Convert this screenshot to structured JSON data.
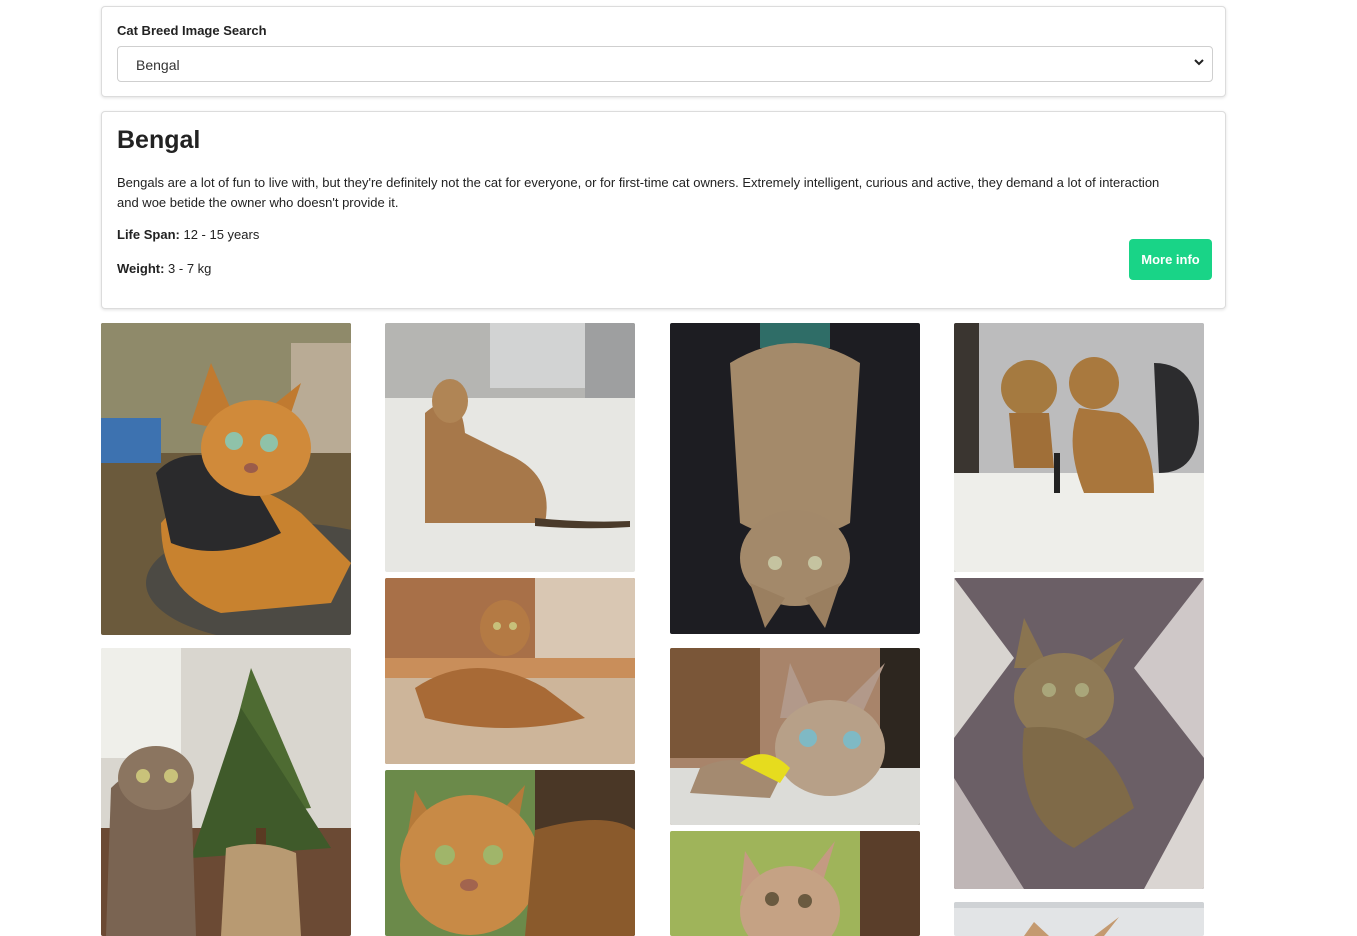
{
  "search": {
    "label": "Cat Breed Image Search",
    "selected": "Bengal"
  },
  "breed": {
    "name": "Bengal",
    "description": "Bengals are a lot of fun to live with, but they're definitely not the cat for everyone, or for first-time cat owners. Extremely intelligent, curious and active, they demand a lot of interaction and woe betide the owner who doesn't provide it.",
    "life_span_label": "Life Span:",
    "life_span": "12 - 15 years",
    "weight_label": "Weight:",
    "weight": "3 - 7 kg",
    "more_info_label": "More info"
  },
  "colors": {
    "accent": "#19d487"
  },
  "gallery": [
    {
      "scene": "bengal-harness-outdoor"
    },
    {
      "scene": "bengal-sitting-floor"
    },
    {
      "scene": "bengal-upside-down"
    },
    {
      "scene": "bengal-mirror"
    },
    {
      "scene": "bengal-christmas-tree"
    },
    {
      "scene": "bengal-on-bed"
    },
    {
      "scene": "bengal-closeup"
    },
    {
      "scene": "bengal-with-toy"
    },
    {
      "scene": "bengal-fur-blanket"
    },
    {
      "scene": "bengal-kitten"
    },
    {
      "scene": "bengal-partial"
    }
  ]
}
